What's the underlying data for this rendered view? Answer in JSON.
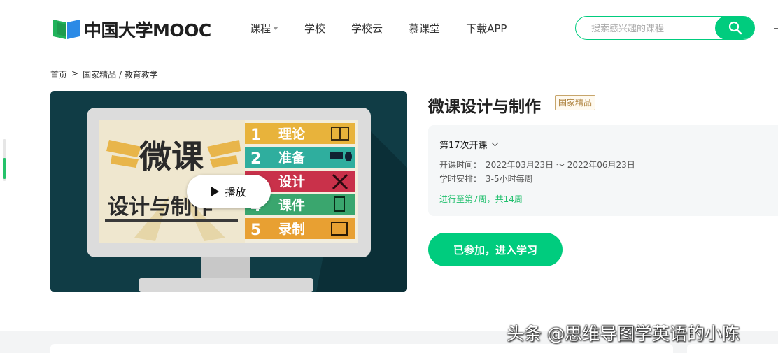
{
  "header": {
    "logo_text": "中国大学MOOC",
    "nav": [
      {
        "label": "课程",
        "has_dropdown": true
      },
      {
        "label": "学校",
        "has_dropdown": false
      },
      {
        "label": "学校云",
        "has_dropdown": false
      },
      {
        "label": "慕课堂",
        "has_dropdown": false
      },
      {
        "label": "下载APP",
        "has_dropdown": false
      }
    ],
    "search": {
      "placeholder": "搜索感兴趣的课程",
      "value": "",
      "icon": "search-icon"
    }
  },
  "breadcrumb": [
    "首页",
    ">",
    "国家精品 / 教育教学"
  ],
  "video": {
    "play_label": "播放",
    "thumbnail": {
      "title_line1": "微课",
      "title_line2": "设计与制作",
      "steps": [
        {
          "num": "1",
          "text": "理论"
        },
        {
          "num": "2",
          "text": "准备"
        },
        {
          "num": "3",
          "text": "设计"
        },
        {
          "num": "4",
          "text": "课件"
        },
        {
          "num": "5",
          "text": "录制"
        }
      ]
    }
  },
  "course": {
    "title": "微课设计与制作",
    "badge": "国家精品",
    "session": "第17次开课",
    "start_label": "开课时间：",
    "start_value": "2022年03月23日 ～ 2022年06月23日",
    "hours_label": "学时安排：",
    "hours_value": "3-5小时每周",
    "progress": "进行至第7周，共14周",
    "join_button": "已参加，进入学习"
  },
  "watermark": "头条 @思维导图学英语的小陈",
  "colors": {
    "brand_green": "#00cc7e",
    "progress_green": "#1fbf6c",
    "badge_gold": "#b08440"
  }
}
